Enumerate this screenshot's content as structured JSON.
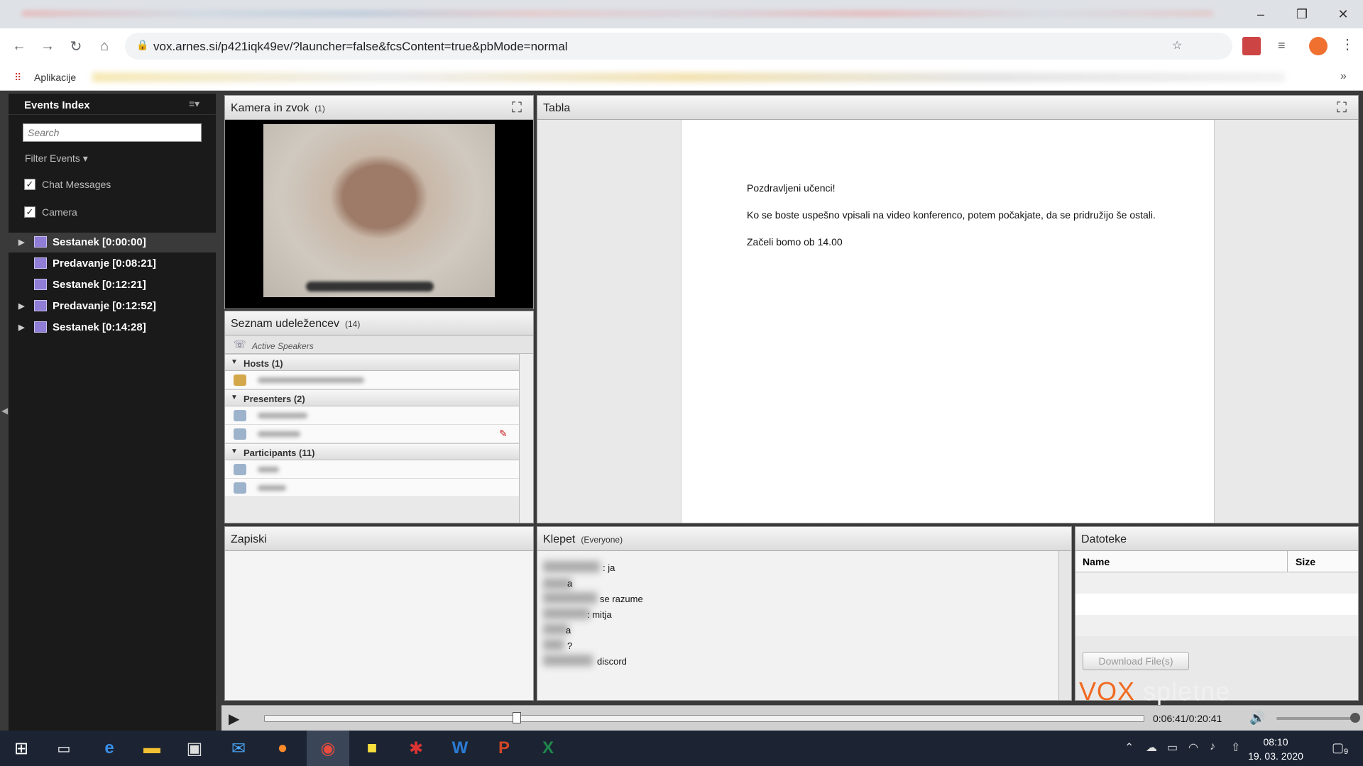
{
  "browser": {
    "url": "vox.arnes.si/p421iqk49ev/?launcher=false&fcsContent=true&pbMode=normal",
    "bookmarks_apps": "Aplikacije",
    "more": "»"
  },
  "events": {
    "title": "Events Index",
    "search_placeholder": "Search",
    "filter_label": "Filter Events",
    "filters": [
      {
        "label": "Chat Messages",
        "checked": true
      },
      {
        "label": "Camera",
        "checked": true
      }
    ],
    "items": [
      {
        "label": "Sestanek [0:00:00]",
        "expandable": true,
        "selected": true
      },
      {
        "label": "Predavanje [0:08:21]",
        "expandable": false
      },
      {
        "label": "Sestanek [0:12:21]",
        "expandable": false
      },
      {
        "label": "Predavanje [0:12:52]",
        "expandable": true
      },
      {
        "label": "Sestanek [0:14:28]",
        "expandable": true
      }
    ]
  },
  "camera": {
    "title": "Kamera in zvok",
    "count": "(1)"
  },
  "attendees": {
    "title": "Seznam udeležencev",
    "count": "(14)",
    "active_speakers": "Active Speakers",
    "groups": [
      {
        "label": "Hosts (1)"
      },
      {
        "label": "Presenters (2)"
      },
      {
        "label": "Participants (11)"
      }
    ]
  },
  "tabla": {
    "title": "Tabla",
    "lines": [
      "Pozdravljeni učenci!",
      "Ko se boste uspešno vpisali na video konferenco, potem počakjate, da se pridružijo še ostali.",
      "Začeli bomo ob 14.00"
    ]
  },
  "zapiski": {
    "title": "Zapiski"
  },
  "klepet": {
    "title": "Klepet",
    "sub": "(Everyone)",
    "messages": [
      ": ja",
      "a",
      "se razume",
      ": mitja",
      "a",
      "?",
      "discord"
    ]
  },
  "datoteke": {
    "title": "Datoteke",
    "col_name": "Name",
    "col_size": "Size",
    "download": "Download File(s)"
  },
  "logo": {
    "v": "VOX",
    "rest": " spletne konference"
  },
  "player": {
    "time": "0:06:41/0:20:41"
  },
  "taskbar": {
    "time": "08:10",
    "date": "19. 03. 2020",
    "notif": "9"
  }
}
